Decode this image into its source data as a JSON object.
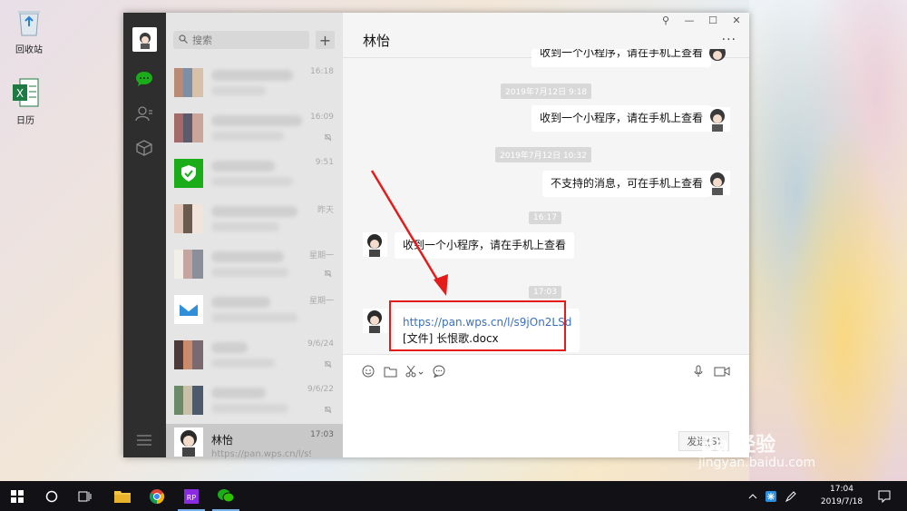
{
  "desktop": {
    "icons": [
      {
        "label": "回收站",
        "icon": "recycle-bin-icon"
      },
      {
        "label": "日历",
        "icon": "excel-icon"
      }
    ],
    "watermark": {
      "logo": "Bai经验",
      "url": "jingyan.baidu.com"
    }
  },
  "wechat": {
    "search_placeholder": "搜索",
    "add_button": "+",
    "conversations": [
      {
        "time": "16:18",
        "muted": false
      },
      {
        "time": "16:09",
        "muted": true
      },
      {
        "time": "9:51",
        "muted": false
      },
      {
        "time": "昨天",
        "muted": false
      },
      {
        "time": "星期一",
        "muted": true
      },
      {
        "time": "星期一",
        "muted": false
      },
      {
        "time": "9/6/24",
        "muted": true
      },
      {
        "time": "9/6/22",
        "muted": true
      },
      {
        "name": "林怡",
        "time": "17:03",
        "message": "https://pan.wps.cn/l/s9..."
      }
    ],
    "chat": {
      "title": "林怡",
      "more_label": "···",
      "window_controls": [
        "⚲",
        "—",
        "☐",
        "✕"
      ],
      "messages": [
        {
          "type": "out",
          "text": "收到一个小程序，请在手机上查看"
        },
        {
          "type": "time",
          "text": "2019年7月12日 9:18"
        },
        {
          "type": "out",
          "text": "收到一个小程序，请在手机上查看"
        },
        {
          "type": "time",
          "text": "2019年7月12日 10:32"
        },
        {
          "type": "out",
          "text": "不支持的消息，可在手机上查看"
        },
        {
          "type": "time",
          "text": "16:17"
        },
        {
          "type": "in",
          "text": "收到一个小程序，请在手机上查看"
        },
        {
          "type": "time",
          "text": "17:03"
        },
        {
          "type": "in",
          "link": "https://pan.wps.cn/l/s9jOn2LSd",
          "file": "[文件] 长恨歌.docx"
        }
      ],
      "send_label": "发送(S)"
    }
  },
  "taskbar": {
    "time": "17:04",
    "date": "2019/7/18",
    "apps": [
      "file-explorer",
      "chrome",
      "axure-rp",
      "wechat"
    ]
  },
  "colors": {
    "accent_green": "#1aad19",
    "highlight_red": "#e31b1b",
    "link_blue": "#3a6fbf"
  }
}
